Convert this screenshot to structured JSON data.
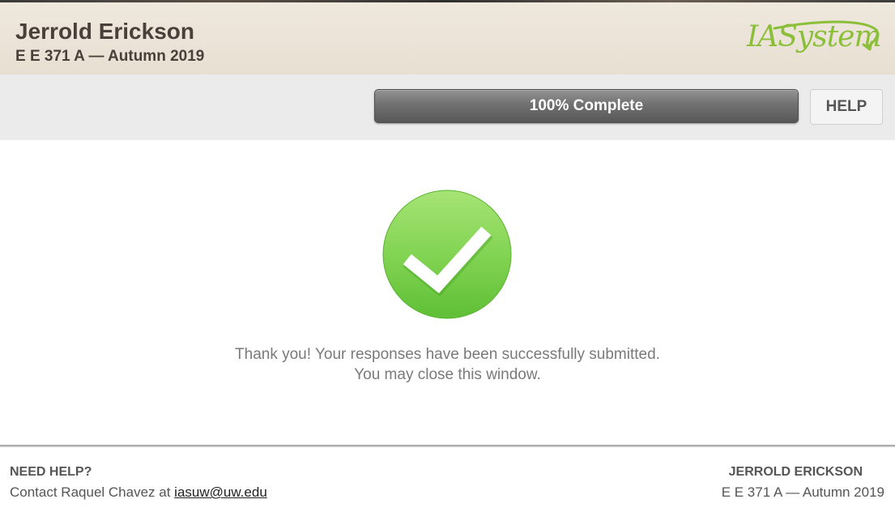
{
  "header": {
    "instructor_name": "Jerrold Erickson",
    "course": "E E 371 A — Autumn 2019",
    "logo_text": "IASystem",
    "colors": {
      "header_bg": "#efe8dd",
      "title_text": "#4a3f3a",
      "logo_green": "#8bbf3a"
    }
  },
  "toolbar": {
    "progress": {
      "label": "100% Complete",
      "value": 1.0
    },
    "help_label": "HELP"
  },
  "main": {
    "success_icon": "checkmark-circle-icon",
    "message_line1": "Thank you! Your responses have been successfully submitted.",
    "message_line2": "You may close this window.",
    "colors": {
      "success_green": "#72cc48"
    }
  },
  "footer": {
    "need_help_heading": "NEED HELP?",
    "contact_prefix": "Contact Raquel Chavez at ",
    "contact_email": "iasuw@uw.edu",
    "instructor_upper": "JERROLD ERICKSON",
    "course": "E E 371 A — Autumn 2019"
  }
}
